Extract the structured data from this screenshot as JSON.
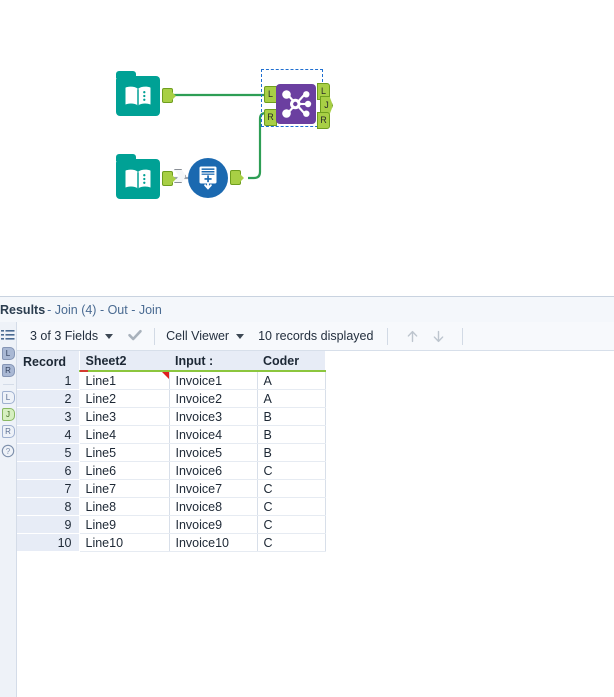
{
  "canvas": {
    "nodes": [
      {
        "id": "input-1",
        "type": "input-data-tool",
        "icon": "book-icon",
        "color": "#00a195",
        "output_anchor": "output-anchor"
      },
      {
        "id": "input-2",
        "type": "input-data-tool",
        "icon": "book-icon",
        "color": "#00a195",
        "output_anchor": "output-anchor"
      },
      {
        "id": "union-1",
        "type": "union-tool",
        "icon": "union-icon",
        "color": "#1b69b0",
        "input_anchor": "input-anchor",
        "output_anchor": "output-anchor"
      },
      {
        "id": "join-1",
        "type": "join-tool",
        "icon": "join-icon",
        "color": "#6b3fa0",
        "selected": true,
        "input_anchors": [
          "L",
          "R"
        ],
        "output_anchors": [
          "L",
          "J",
          "R"
        ]
      }
    ],
    "connection_colors": {
      "active": "#2e9e55",
      "inactive": "#9aa3ad"
    }
  },
  "results": {
    "title": "Results",
    "breadcrumb": " - Join (4) - Out - Join",
    "toolbar": {
      "fields_label": "3 of 3 Fields",
      "fields_caret": "chevron-down-icon",
      "check_icon": "checkmark-icon",
      "view_label": "Cell Viewer",
      "view_caret": "chevron-down-icon",
      "records_label": "10 records displayed",
      "prev_icon": "arrow-up-icon",
      "next_icon": "arrow-down-icon"
    },
    "rail": {
      "list_icon": "list-icon",
      "help_icon": "help-icon",
      "badges_top": [
        {
          "label": "L",
          "style": "solid"
        },
        {
          "label": "R",
          "style": "solid"
        }
      ],
      "badges_bottom": [
        {
          "label": "L",
          "style": "outline"
        },
        {
          "label": "J",
          "style": "active"
        },
        {
          "label": "R",
          "style": "outline"
        }
      ]
    },
    "table": {
      "columns": [
        "Record",
        "Sheet2",
        "Input :",
        "Coder"
      ],
      "rows": [
        {
          "record": "1",
          "sheet2": "Line1",
          "input": "Invoice1",
          "coder": "A",
          "flag": true
        },
        {
          "record": "2",
          "sheet2": "Line2",
          "input": "Invoice2",
          "coder": "A",
          "flag": false
        },
        {
          "record": "3",
          "sheet2": "Line3",
          "input": "Invoice3",
          "coder": "B",
          "flag": false
        },
        {
          "record": "4",
          "sheet2": "Line4",
          "input": "Invoice4",
          "coder": "B",
          "flag": false
        },
        {
          "record": "5",
          "sheet2": "Line5",
          "input": "Invoice5",
          "coder": "B",
          "flag": false
        },
        {
          "record": "6",
          "sheet2": "Line6",
          "input": "Invoice6",
          "coder": "C",
          "flag": false
        },
        {
          "record": "7",
          "sheet2": "Line7",
          "input": "Invoice7",
          "coder": "C",
          "flag": false
        },
        {
          "record": "8",
          "sheet2": "Line8",
          "input": "Invoice8",
          "coder": "C",
          "flag": false
        },
        {
          "record": "9",
          "sheet2": "Line9",
          "input": "Invoice9",
          "coder": "C",
          "flag": false
        },
        {
          "record": "10",
          "sheet2": "Line10",
          "input": "Invoice10",
          "coder": "C",
          "flag": false
        }
      ]
    }
  }
}
